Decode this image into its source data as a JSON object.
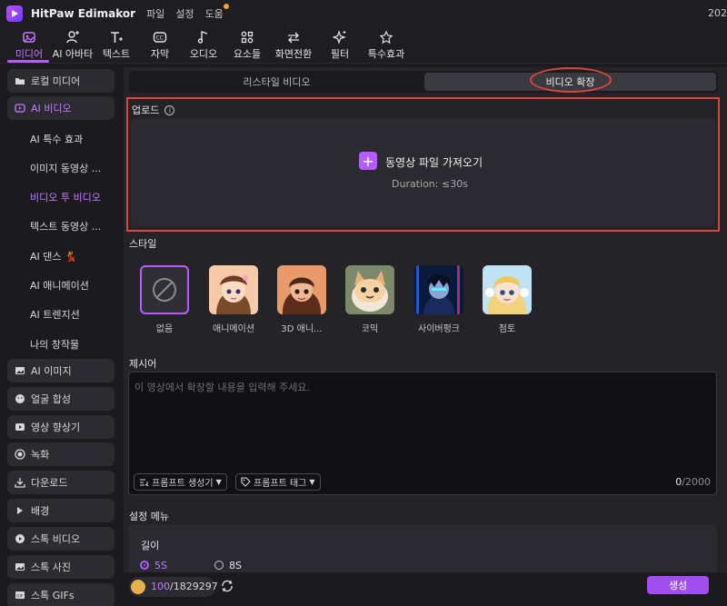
{
  "app": {
    "name": "HitPaw Edimakor",
    "menu": [
      "파일",
      "설정",
      "도움"
    ],
    "year": "202"
  },
  "toolbar": {
    "tools": [
      {
        "label": "미디어",
        "icon": "media-icon"
      },
      {
        "label": "AI 아바타",
        "icon": "ai-avatar-icon"
      },
      {
        "label": "텍스트",
        "icon": "text-icon"
      },
      {
        "label": "자막",
        "icon": "subtitle-icon"
      },
      {
        "label": "오디오",
        "icon": "audio-icon"
      },
      {
        "label": "요소들",
        "icon": "elements-icon"
      },
      {
        "label": "화면전환",
        "icon": "transition-icon"
      },
      {
        "label": "필터",
        "icon": "filter-icon"
      },
      {
        "label": "특수효과",
        "icon": "effects-icon"
      }
    ],
    "active_color": "#c37cff"
  },
  "sidebar": {
    "top_items": [
      {
        "label": "로컬 미디어",
        "icon": "folder-icon"
      },
      {
        "label": "AI 비디오",
        "icon": "ai-video-icon"
      }
    ],
    "sub_items": [
      "AI 특수 효과",
      "이미지 동영상 ...",
      "비디오 투 비디오",
      "텍스트 동영상 ...",
      "AI 댄스 💃",
      "AI 애니메이션",
      "AI 트렌지션",
      "나의 창작물"
    ],
    "bottom_items": [
      {
        "label": "AI 이미지",
        "icon": "image-icon"
      },
      {
        "label": "얼굴 합성",
        "icon": "face-icon"
      },
      {
        "label": "영상 향상기",
        "icon": "enhance-icon"
      },
      {
        "label": "녹화",
        "icon": "record-icon"
      },
      {
        "label": "다운로드",
        "icon": "download-icon"
      },
      {
        "label": "배경",
        "icon": "play-icon"
      },
      {
        "label": "스톡 비디오",
        "icon": "stock-video-icon"
      },
      {
        "label": "스톡 사진",
        "icon": "stock-photo-icon"
      },
      {
        "label": "스톡 GIFs",
        "icon": "gif-icon"
      }
    ]
  },
  "tabs": {
    "left": "리스타일 비디오",
    "right": "비디오 확장"
  },
  "upload": {
    "label": "업로드",
    "button": "동영상 파일 가져오기",
    "duration": "Duration: ≤30s"
  },
  "style": {
    "title": "스타일",
    "items": [
      "없음",
      "애니메이션",
      "3D 애니...",
      "코믹",
      "사이버펑크",
      "점토"
    ]
  },
  "prompt": {
    "title": "제시어",
    "placeholder": "이 영상에서 확장할 내용을 입력해 주세요.",
    "generator": "프롬프트 생성기",
    "tags": "프롬프트 태그",
    "count": "0",
    "max": "/2000"
  },
  "settings": {
    "title": "설정 메뉴",
    "length_label": "길이",
    "options": [
      "5S",
      "8S"
    ],
    "selected": "5S"
  },
  "footer": {
    "used": "100",
    "total": "/1829297",
    "generate": "생성"
  },
  "colors": {
    "accent": "#b45cff",
    "highlight": "#e0443e"
  }
}
